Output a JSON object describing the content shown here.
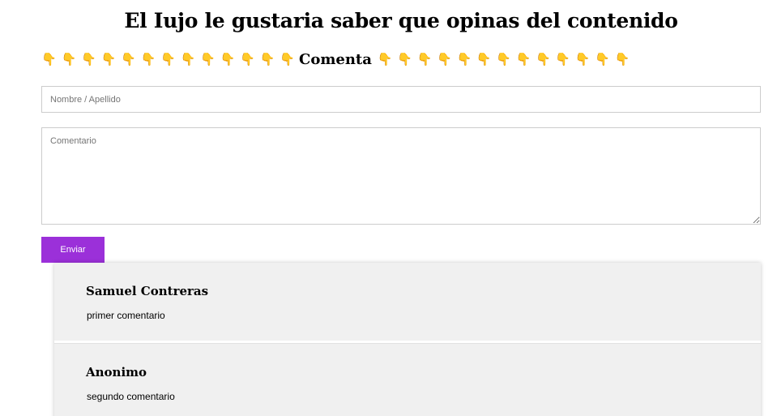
{
  "header": {
    "title": "El Iujo le gustaria saber que opinas del contenido"
  },
  "subtitle": {
    "label": "Comenta",
    "icon": "hand-pointing-down-icon",
    "glyph": "👇"
  },
  "form": {
    "name_placeholder": "Nombre / Apellido",
    "name_value": "",
    "comment_placeholder": "Comentario",
    "comment_value": "",
    "submit_label": "Enviar",
    "accent_color": "#9b30d9"
  },
  "comments": [
    {
      "author": "Samuel Contreras",
      "text": "primer comentario"
    },
    {
      "author": "Anonimo",
      "text": "segundo comentario"
    }
  ]
}
